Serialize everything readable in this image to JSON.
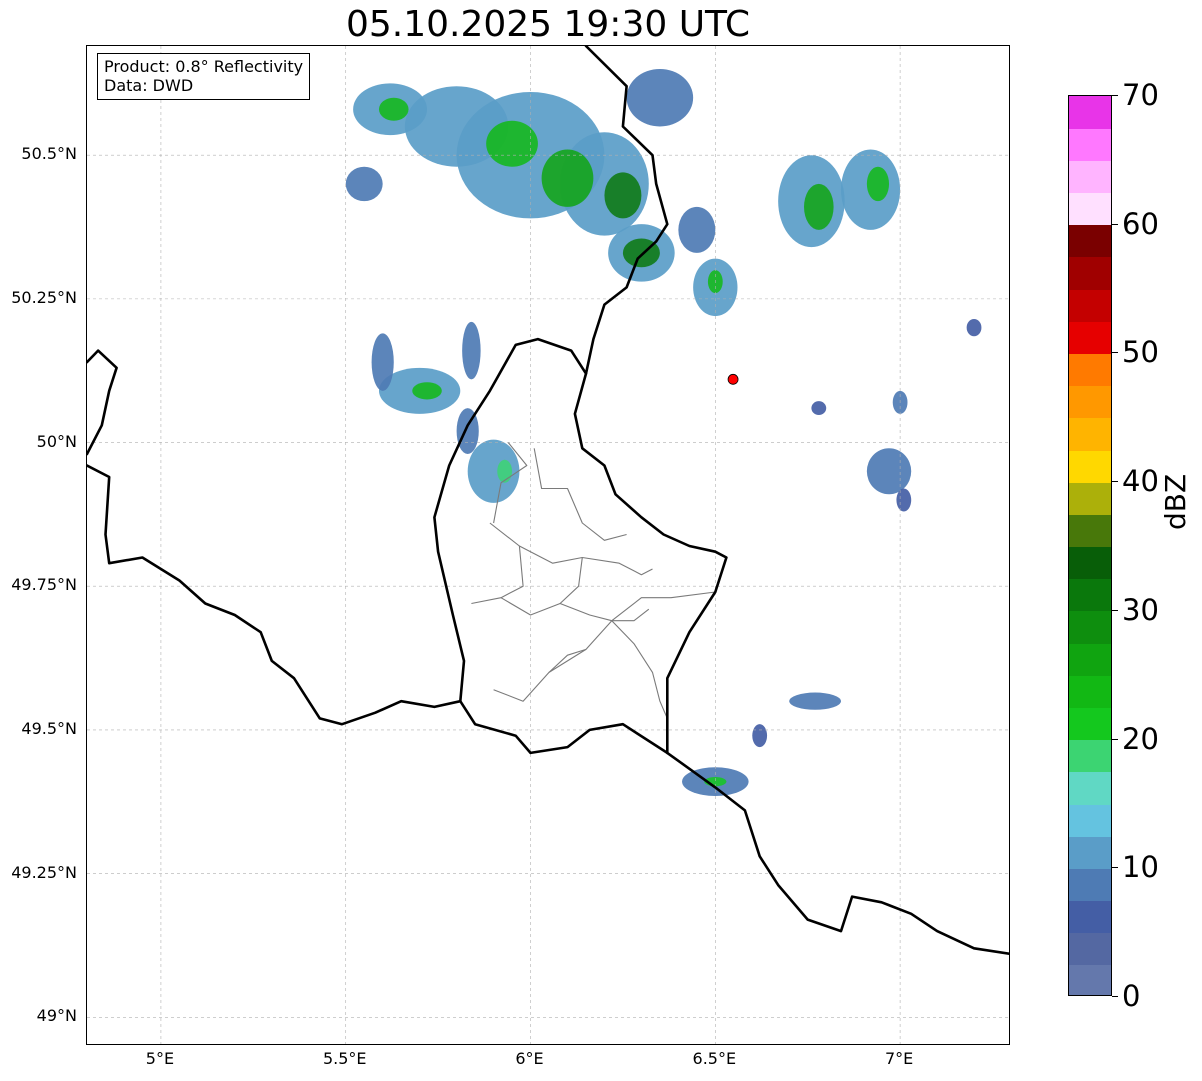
{
  "title": "05.10.2025 19:30 UTC",
  "info": {
    "product": "Product: 0.8° Reflectivity",
    "source": "Data: DWD"
  },
  "map": {
    "lon_range": [
      4.8,
      7.3
    ],
    "lat_range": [
      48.95,
      50.69
    ],
    "lon_ticks": [
      5.0,
      5.5,
      6.0,
      6.5,
      7.0
    ],
    "lon_tick_labels": [
      "5°E",
      "5.5°E",
      "6°E",
      "6.5°E",
      "7°E"
    ],
    "lat_ticks": [
      49.0,
      49.25,
      49.5,
      49.75,
      50.0,
      50.25,
      50.5
    ],
    "lat_tick_labels": [
      "49°N",
      "49.25°N",
      "49.5°N",
      "49.75°N",
      "50°N",
      "50.25°N",
      "50.5°N"
    ],
    "gridlines": true,
    "radar_site": {
      "lon": 6.548,
      "lat": 50.11,
      "color": "#ff0000"
    },
    "national_borders": [
      [
        [
          4.8,
          50.14
        ],
        [
          4.83,
          50.16
        ],
        [
          4.88,
          50.13
        ],
        [
          4.86,
          50.09
        ],
        [
          4.84,
          50.03
        ],
        [
          4.8,
          49.98
        ]
      ],
      [
        [
          4.8,
          49.96
        ],
        [
          4.86,
          49.94
        ],
        [
          4.85,
          49.84
        ],
        [
          4.86,
          49.79
        ],
        [
          4.95,
          49.8
        ],
        [
          5.05,
          49.76
        ],
        [
          5.12,
          49.72
        ],
        [
          5.2,
          49.7
        ],
        [
          5.27,
          49.67
        ],
        [
          5.3,
          49.62
        ],
        [
          5.36,
          49.59
        ],
        [
          5.43,
          49.52
        ],
        [
          5.49,
          49.51
        ],
        [
          5.58,
          49.53
        ],
        [
          5.65,
          49.55
        ],
        [
          5.74,
          49.54
        ],
        [
          5.81,
          49.55
        ],
        [
          5.85,
          49.51
        ],
        [
          5.96,
          49.49
        ],
        [
          6.0,
          49.46
        ],
        [
          6.1,
          49.47
        ],
        [
          6.16,
          49.5
        ],
        [
          6.25,
          49.51
        ],
        [
          6.37,
          49.46
        ],
        [
          6.5,
          49.4
        ],
        [
          6.58,
          49.36
        ],
        [
          6.62,
          49.28
        ],
        [
          6.67,
          49.23
        ],
        [
          6.75,
          49.17
        ],
        [
          6.84,
          49.15
        ],
        [
          6.87,
          49.21
        ],
        [
          6.95,
          49.2
        ],
        [
          7.03,
          49.18
        ],
        [
          7.1,
          49.15
        ],
        [
          7.2,
          49.12
        ],
        [
          7.3,
          49.11
        ]
      ],
      [
        [
          5.81,
          49.55
        ],
        [
          5.82,
          49.62
        ],
        [
          5.79,
          49.7
        ],
        [
          5.75,
          49.81
        ],
        [
          5.74,
          49.87
        ],
        [
          5.78,
          49.96
        ],
        [
          5.83,
          50.03
        ],
        [
          5.89,
          50.09
        ],
        [
          5.96,
          50.17
        ],
        [
          6.02,
          50.18
        ],
        [
          6.11,
          50.16
        ],
        [
          6.15,
          50.12
        ],
        [
          6.12,
          50.05
        ],
        [
          6.14,
          49.99
        ],
        [
          6.2,
          49.96
        ],
        [
          6.23,
          49.91
        ],
        [
          6.3,
          49.87
        ],
        [
          6.36,
          49.84
        ],
        [
          6.43,
          49.82
        ],
        [
          6.5,
          49.81
        ],
        [
          6.53,
          49.8
        ],
        [
          6.5,
          49.74
        ],
        [
          6.43,
          49.67
        ],
        [
          6.37,
          49.59
        ],
        [
          6.37,
          49.46
        ]
      ],
      [
        [
          6.15,
          50.12
        ],
        [
          6.17,
          50.18
        ],
        [
          6.2,
          50.24
        ],
        [
          6.26,
          50.27
        ],
        [
          6.29,
          50.32
        ],
        [
          6.34,
          50.35
        ],
        [
          6.37,
          50.38
        ],
        [
          6.34,
          50.45
        ],
        [
          6.33,
          50.5
        ],
        [
          6.25,
          50.55
        ],
        [
          6.26,
          50.62
        ],
        [
          6.15,
          50.69
        ]
      ]
    ],
    "region_borders": [
      [
        [
          5.94,
          50.0
        ],
        [
          5.99,
          49.96
        ],
        [
          5.92,
          49.93
        ],
        [
          5.9,
          49.86
        ]
      ],
      [
        [
          6.01,
          49.99
        ],
        [
          6.03,
          49.92
        ],
        [
          6.1,
          49.92
        ],
        [
          6.14,
          49.86
        ],
        [
          6.2,
          49.83
        ],
        [
          6.26,
          49.84
        ]
      ],
      [
        [
          5.89,
          49.86
        ],
        [
          5.97,
          49.82
        ],
        [
          6.06,
          49.79
        ],
        [
          6.14,
          49.8
        ],
        [
          6.24,
          49.79
        ],
        [
          6.3,
          49.77
        ],
        [
          6.33,
          49.78
        ]
      ],
      [
        [
          6.14,
          49.8
        ],
        [
          6.13,
          49.75
        ],
        [
          6.08,
          49.72
        ],
        [
          6.16,
          49.7
        ],
        [
          6.22,
          49.69
        ],
        [
          6.28,
          49.69
        ],
        [
          6.32,
          49.71
        ]
      ],
      [
        [
          5.97,
          49.82
        ],
        [
          5.98,
          49.75
        ],
        [
          5.92,
          49.73
        ],
        [
          5.84,
          49.72
        ]
      ],
      [
        [
          5.92,
          49.73
        ],
        [
          6.0,
          49.7
        ],
        [
          6.08,
          49.72
        ]
      ],
      [
        [
          6.22,
          49.69
        ],
        [
          6.3,
          49.73
        ],
        [
          6.38,
          49.73
        ],
        [
          6.5,
          49.74
        ]
      ],
      [
        [
          6.22,
          49.69
        ],
        [
          6.28,
          49.65
        ],
        [
          6.33,
          49.6
        ],
        [
          6.35,
          49.55
        ],
        [
          6.37,
          49.52
        ]
      ],
      [
        [
          6.22,
          49.69
        ],
        [
          6.15,
          49.64
        ],
        [
          6.05,
          49.6
        ],
        [
          5.98,
          49.55
        ],
        [
          5.9,
          49.57
        ]
      ],
      [
        [
          6.05,
          49.6
        ],
        [
          6.1,
          49.63
        ],
        [
          6.15,
          49.64
        ]
      ]
    ],
    "precipitation_cells": [
      {
        "lon": 5.62,
        "lat": 50.58,
        "rlon": 0.1,
        "rlat": 0.045,
        "dbz": 12
      },
      {
        "lon": 5.8,
        "lat": 50.55,
        "rlon": 0.14,
        "rlat": 0.07,
        "dbz": 10
      },
      {
        "lon": 6.0,
        "lat": 50.5,
        "rlon": 0.2,
        "rlat": 0.11,
        "dbz": 12
      },
      {
        "lon": 6.2,
        "lat": 50.45,
        "rlon": 0.12,
        "rlat": 0.09,
        "dbz": 11
      },
      {
        "lon": 6.3,
        "lat": 50.33,
        "rlon": 0.09,
        "rlat": 0.05,
        "dbz": 12
      },
      {
        "lon": 6.45,
        "lat": 50.37,
        "rlon": 0.05,
        "rlat": 0.04,
        "dbz": 9
      },
      {
        "lon": 6.35,
        "lat": 50.6,
        "rlon": 0.09,
        "rlat": 0.05,
        "dbz": 8
      },
      {
        "lon": 5.55,
        "lat": 50.45,
        "rlon": 0.05,
        "rlat": 0.03,
        "dbz": 8
      },
      {
        "lon": 6.5,
        "lat": 50.27,
        "rlon": 0.06,
        "rlat": 0.05,
        "dbz": 11
      },
      {
        "lon": 6.76,
        "lat": 50.42,
        "rlon": 0.09,
        "rlat": 0.08,
        "dbz": 12
      },
      {
        "lon": 6.92,
        "lat": 50.44,
        "rlon": 0.08,
        "rlat": 0.07,
        "dbz": 11
      },
      {
        "lon": 7.2,
        "lat": 50.2,
        "rlon": 0.02,
        "rlat": 0.015,
        "dbz": 7
      },
      {
        "lon": 5.7,
        "lat": 50.09,
        "rlon": 0.11,
        "rlat": 0.04,
        "dbz": 11
      },
      {
        "lon": 5.6,
        "lat": 50.14,
        "rlon": 0.03,
        "rlat": 0.05,
        "dbz": 9
      },
      {
        "lon": 5.84,
        "lat": 50.16,
        "rlon": 0.025,
        "rlat": 0.05,
        "dbz": 9
      },
      {
        "lon": 5.9,
        "lat": 49.95,
        "rlon": 0.07,
        "rlat": 0.055,
        "dbz": 11
      },
      {
        "lon": 5.83,
        "lat": 50.02,
        "rlon": 0.03,
        "rlat": 0.04,
        "dbz": 8
      },
      {
        "lon": 6.78,
        "lat": 50.06,
        "rlon": 0.02,
        "rlat": 0.012,
        "dbz": 7
      },
      {
        "lon": 7.0,
        "lat": 50.07,
        "rlon": 0.02,
        "rlat": 0.02,
        "dbz": 8
      },
      {
        "lon": 6.97,
        "lat": 49.95,
        "rlon": 0.06,
        "rlat": 0.04,
        "dbz": 9
      },
      {
        "lon": 7.01,
        "lat": 49.9,
        "rlon": 0.02,
        "rlat": 0.02,
        "dbz": 7
      },
      {
        "lon": 6.77,
        "lat": 49.55,
        "rlon": 0.07,
        "rlat": 0.015,
        "dbz": 8
      },
      {
        "lon": 6.62,
        "lat": 49.49,
        "rlon": 0.02,
        "rlat": 0.02,
        "dbz": 7
      },
      {
        "lon": 6.5,
        "lat": 49.41,
        "rlon": 0.09,
        "rlat": 0.025,
        "dbz": 9
      }
    ],
    "cell_cores": [
      {
        "lon": 5.63,
        "lat": 50.58,
        "rlon": 0.04,
        "rlat": 0.02,
        "dbz": 24
      },
      {
        "lon": 5.95,
        "lat": 50.52,
        "rlon": 0.07,
        "rlat": 0.04,
        "dbz": 24
      },
      {
        "lon": 6.1,
        "lat": 50.46,
        "rlon": 0.07,
        "rlat": 0.05,
        "dbz": 26
      },
      {
        "lon": 6.25,
        "lat": 50.43,
        "rlon": 0.05,
        "rlat": 0.04,
        "dbz": 30
      },
      {
        "lon": 6.3,
        "lat": 50.33,
        "rlon": 0.05,
        "rlat": 0.025,
        "dbz": 30
      },
      {
        "lon": 6.5,
        "lat": 50.28,
        "rlon": 0.02,
        "rlat": 0.02,
        "dbz": 24
      },
      {
        "lon": 6.78,
        "lat": 50.41,
        "rlon": 0.04,
        "rlat": 0.04,
        "dbz": 26
      },
      {
        "lon": 6.94,
        "lat": 50.45,
        "rlon": 0.03,
        "rlat": 0.03,
        "dbz": 24
      },
      {
        "lon": 5.72,
        "lat": 50.09,
        "rlon": 0.04,
        "rlat": 0.015,
        "dbz": 24
      },
      {
        "lon": 5.93,
        "lat": 49.95,
        "rlon": 0.02,
        "rlat": 0.02,
        "dbz": 18
      },
      {
        "lon": 6.5,
        "lat": 49.41,
        "rlon": 0.03,
        "rlat": 0.008,
        "dbz": 20
      }
    ]
  },
  "colorbar": {
    "label": "dBZ",
    "min": 0,
    "max": 70,
    "step": 2.5,
    "ticks": [
      "0",
      "10",
      "20",
      "30",
      "40",
      "50",
      "60",
      "70"
    ],
    "colors": [
      "#6478ac",
      "#5468a2",
      "#445ea5",
      "#4e7bb4",
      "#5a9dc8",
      "#64c3e0",
      "#60d8c4",
      "#3cd472",
      "#14c81e",
      "#12b814",
      "#10a410",
      "#0e8e0e",
      "#0a780c",
      "#085e08",
      "#48780a",
      "#acb00a",
      "#ffd800",
      "#ffb400",
      "#ff9800",
      "#ff7a00",
      "#e60000",
      "#c40000",
      "#a00000",
      "#7a0000",
      "#ffe0ff",
      "#ffb4ff",
      "#ff78ff",
      "#e834e8"
    ]
  }
}
